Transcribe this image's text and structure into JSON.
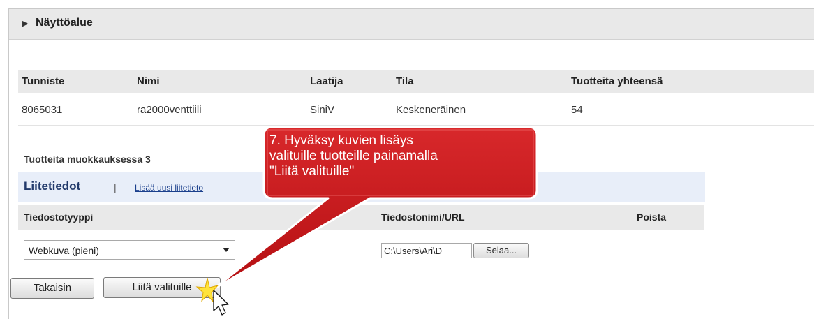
{
  "section": {
    "title": "Näyttöalue"
  },
  "summary": {
    "headers": [
      "Tunniste",
      "Nimi",
      "Laatija",
      "Tila",
      "Tuotteita yhteensä"
    ],
    "row": [
      "8065031",
      "ra2000venttiili",
      "SiniV",
      "Keskeneräinen",
      "54"
    ]
  },
  "editing": {
    "title": "Tuotteita muokkauksessa 3"
  },
  "attachments": {
    "title": "Liitetiedot",
    "separator": "|",
    "add_link": "Lisää uusi liitetieto",
    "columns": [
      "Tiedostotyyppi",
      "Tiedostonimi/URL",
      "Poista"
    ],
    "file_type_value": "Webkuva (pieni)",
    "file_path_value": "C:\\Users\\Ari\\D",
    "browse_label": "Selaa..."
  },
  "buttons": {
    "back": "Takaisin",
    "attach_selected": "Liitä valituille"
  },
  "callout": {
    "lines": [
      "7. Hyväksy kuvien lisäys",
      "valituille tuotteille painamalla",
      "\"Liitä valituille\""
    ],
    "color": "#c9171a"
  }
}
